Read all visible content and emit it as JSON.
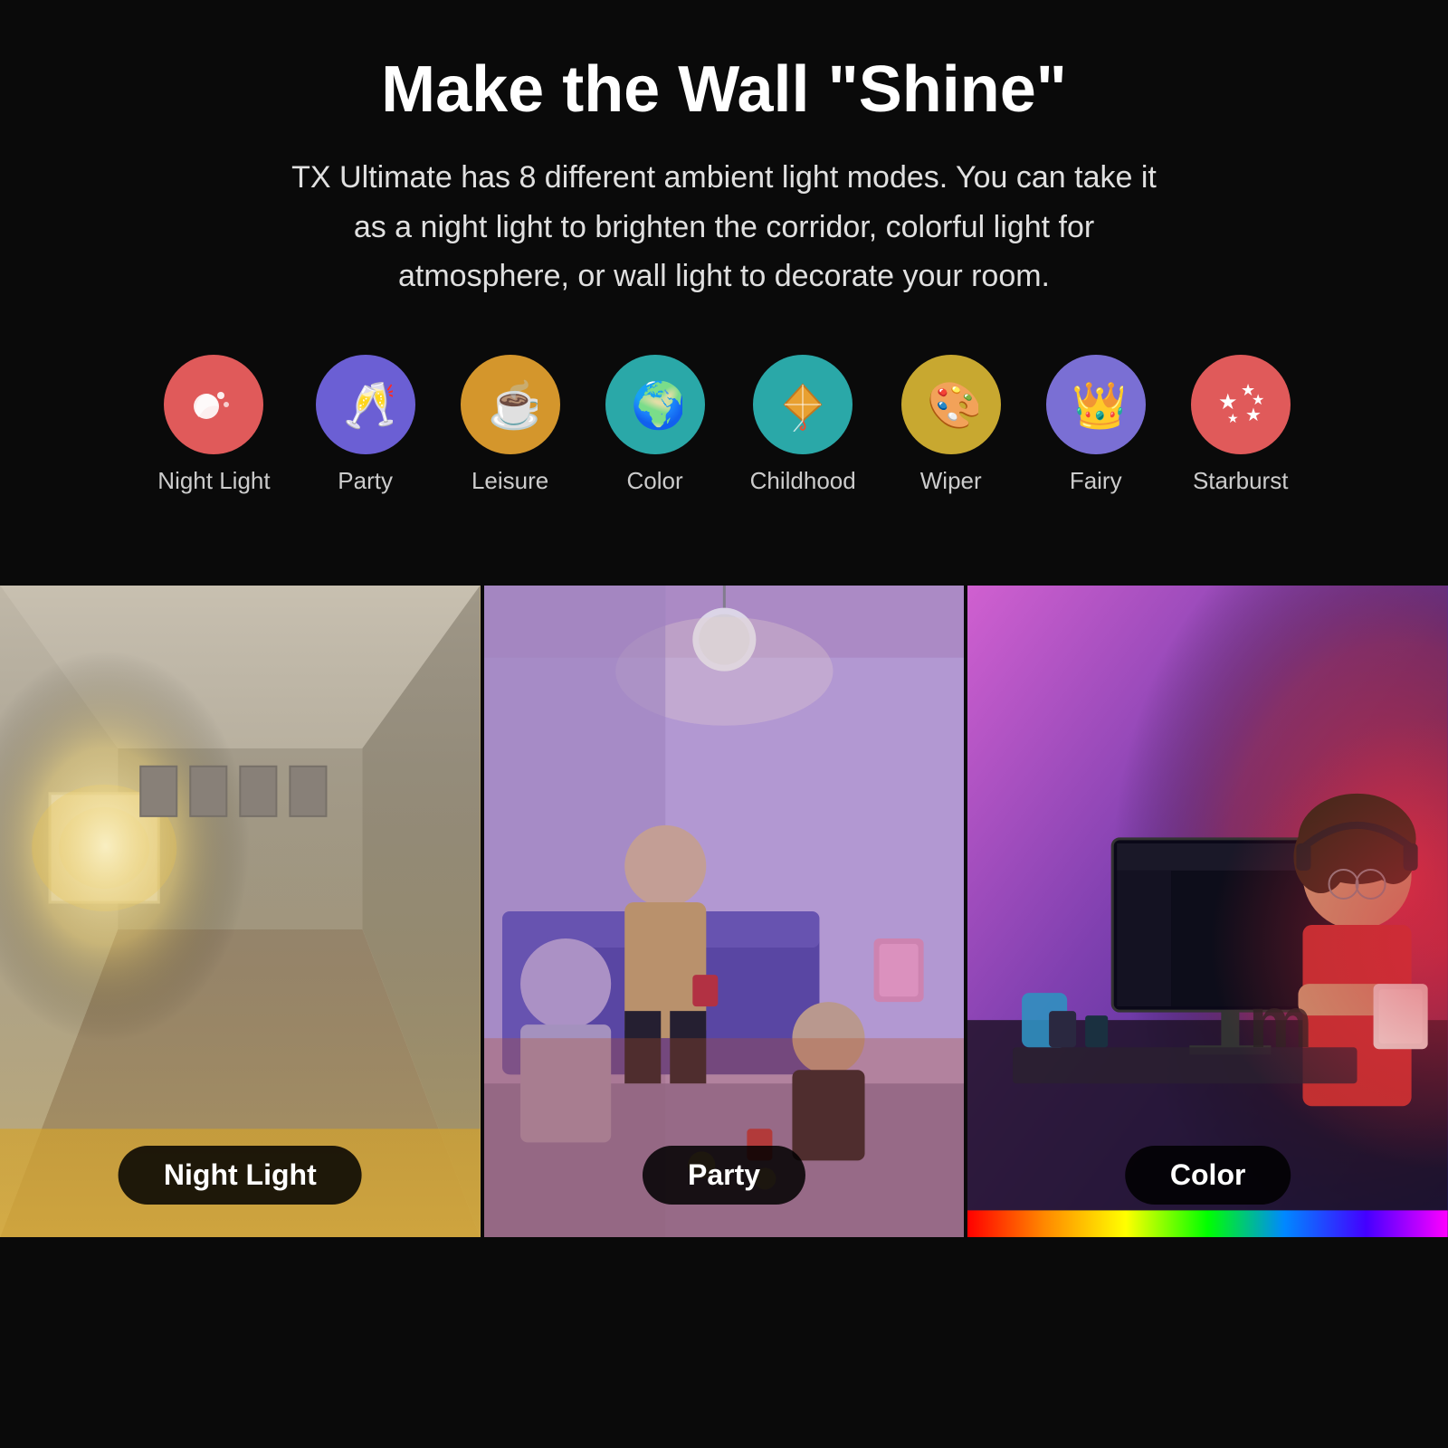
{
  "header": {
    "title": "Make the Wall \"Shine\"",
    "subtitle": "TX Ultimate has 8 different ambient light modes. You can take it as a night light to brighten the corridor, colorful light for atmosphere, or wall light to decorate your room."
  },
  "modes": [
    {
      "id": "night-light",
      "label": "Night Light",
      "emoji": "🌙",
      "bgClass": "icon-night"
    },
    {
      "id": "party",
      "label": "Party",
      "emoji": "🥂",
      "bgClass": "icon-party"
    },
    {
      "id": "leisure",
      "label": "Leisure",
      "emoji": "☕",
      "bgClass": "icon-leisure"
    },
    {
      "id": "color",
      "label": "Color",
      "emoji": "🌍",
      "bgClass": "icon-color"
    },
    {
      "id": "childhood",
      "label": "Childhood",
      "emoji": "🪁",
      "bgClass": "icon-childhood"
    },
    {
      "id": "wiper",
      "label": "Wiper",
      "emoji": "🎨",
      "bgClass": "icon-wiper"
    },
    {
      "id": "fairy",
      "label": "Fairy",
      "emoji": "👑",
      "bgClass": "icon-fairy"
    },
    {
      "id": "starburst",
      "label": "Starburst",
      "emoji": "✨",
      "bgClass": "icon-starburst"
    }
  ],
  "photos": [
    {
      "id": "night-light-photo",
      "label": "Night Light",
      "sceneClass": "night-scene"
    },
    {
      "id": "party-photo",
      "label": "Party",
      "sceneClass": "party-scene"
    },
    {
      "id": "color-photo",
      "label": "Color",
      "sceneClass": "color-scene"
    }
  ]
}
